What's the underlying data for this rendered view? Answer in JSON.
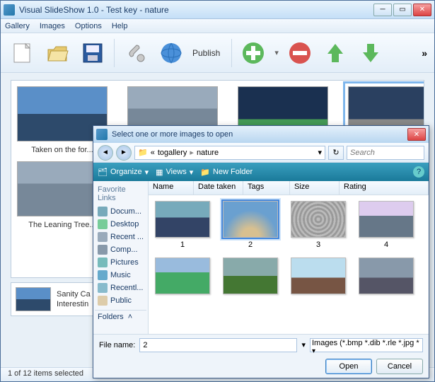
{
  "window": {
    "title": "Visual SlideShow 1.0 - Test key - nature"
  },
  "menu": {
    "gallery": "Gallery",
    "images": "Images",
    "options": "Options",
    "help": "Help"
  },
  "toolbar": {
    "publish": "Publish"
  },
  "thumbs": {
    "items": [
      {
        "caption": "Taken on the for..."
      },
      {
        "caption": ""
      },
      {
        "caption": ""
      },
      {
        "caption": ""
      }
    ],
    "row2_caption": "The Leaning Tree..."
  },
  "detail": {
    "line1": "Sanity Ca",
    "line2": "Interestin"
  },
  "status": "1 of 12 items selected",
  "dialog": {
    "title": "Select one or more images to open",
    "breadcrumb": {
      "level1": "togallery",
      "level2": "nature"
    },
    "search_placeholder": "Search",
    "toolbar": {
      "organize": "Organize",
      "views": "Views",
      "newfolder": "New Folder"
    },
    "side": {
      "header": "Favorite Links",
      "links": [
        "Docum...",
        "Desktop",
        "Recent ...",
        "Comp...",
        "Pictures",
        "Music",
        "Recentl...",
        "Public"
      ],
      "folders": "Folders"
    },
    "columns": {
      "name": "Name",
      "date": "Date taken",
      "tags": "Tags",
      "size": "Size",
      "rating": "Rating"
    },
    "thumbs": [
      "1",
      "2",
      "3",
      "4",
      "",
      "",
      "",
      ""
    ],
    "selected_index": 1,
    "filename_label": "File name:",
    "filename_value": "2",
    "filetype": "Images (*.bmp *.dib *.rle *.jpg *",
    "open": "Open",
    "cancel": "Cancel"
  }
}
